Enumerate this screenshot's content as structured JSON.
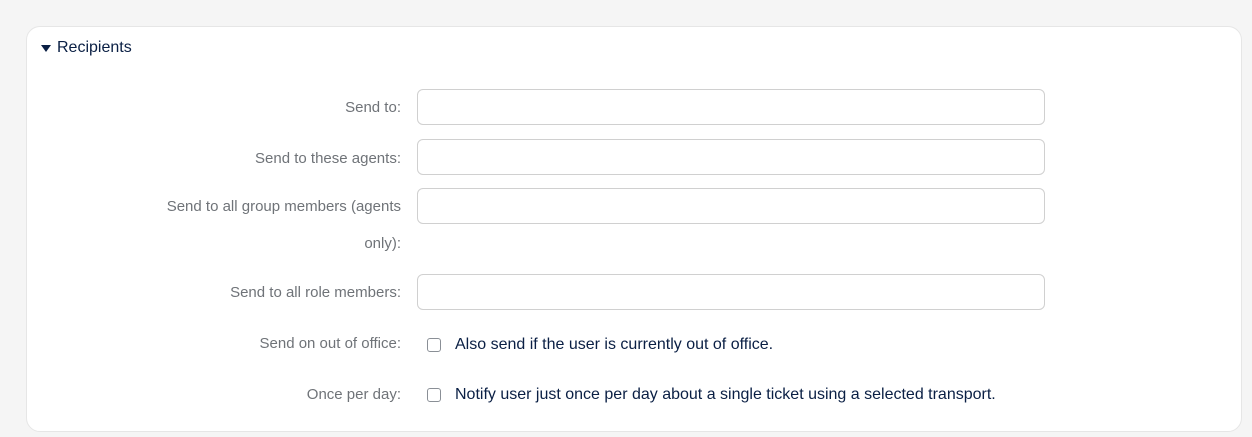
{
  "section": {
    "title": "Recipients",
    "expanded": true
  },
  "fields": {
    "send_to": {
      "label": "Send to:",
      "value": ""
    },
    "send_to_agents": {
      "label": "Send to these agents:",
      "value": ""
    },
    "send_to_group": {
      "label_line1": "Send to all group members (agents",
      "label_line2": "only):",
      "value": ""
    },
    "send_to_roles": {
      "label": "Send to all role members:",
      "value": ""
    }
  },
  "options": {
    "out_of_office": {
      "label": "Send on out of office:",
      "checkbox_label": "Also send if the user is currently out of office.",
      "checked": false
    },
    "once_per_day": {
      "label": "Once per day:",
      "checkbox_label": "Notify user just once per day about a single ticket using a selected transport.",
      "checked": false
    }
  },
  "colors": {
    "title": "#0a1f44",
    "label": "#6f7378",
    "border": "#d0d0d0",
    "background": "#f5f5f5"
  }
}
